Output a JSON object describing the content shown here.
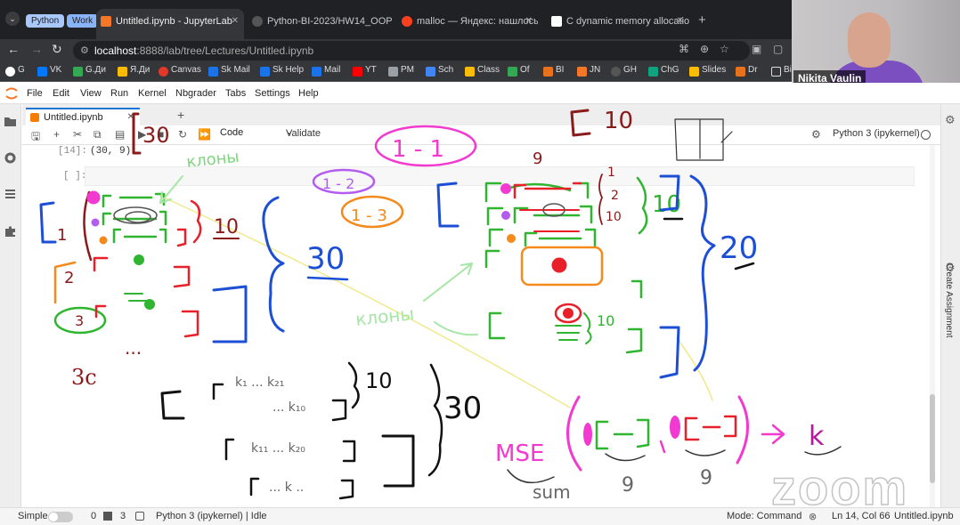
{
  "browser": {
    "tab_groups": [
      {
        "label": "Python",
        "color": "#a8c7fa"
      },
      {
        "label": "Work",
        "color": "#8ab4f8"
      }
    ],
    "tabs": [
      {
        "title": "Untitled.ipynb - JupyterLab",
        "active": true,
        "icon": "jupyter-icon"
      },
      {
        "title": "Python-BI-2023/HW14_OOP: Tr",
        "active": false,
        "icon": "github-icon"
      },
      {
        "title": "malloc — Яндекс: нашлось 3 т",
        "active": false,
        "icon": "yandex-icon"
      },
      {
        "title": "C dynamic memory allocation -",
        "active": false,
        "icon": "wikipedia-icon"
      }
    ],
    "url_host": "localhost",
    "url_path": ":8888/lab/tree/Lectures/Untitled.ipynb",
    "bookmarks": [
      "G",
      "VK",
      "G.Ди",
      "Я.Ди",
      "Canvas",
      "Sk Mail",
      "Sk Help",
      "Mail",
      "YT",
      "PM",
      "Sch",
      "Class",
      "Of",
      "BI",
      "JN",
      "GH",
      "ChG",
      "Slides",
      "Dr",
      "Bio"
    ]
  },
  "webcam": {
    "name": "Nikita Vaulin"
  },
  "jupyter": {
    "menu": [
      "File",
      "Edit",
      "View",
      "Run",
      "Kernel",
      "Nbgrader",
      "Tabs",
      "Settings",
      "Help"
    ],
    "doc_tab": "Untitled.ipynb",
    "cell_type": "Code",
    "validate_label": "Validate",
    "kernel": "Python 3 (ipykernel)",
    "right_panel_label": "Create Assignment",
    "out_prompt": "[14]:",
    "out_text": "(30, 9)",
    "in_prompt": "[ ]:"
  },
  "annotations": {
    "n30a": "30",
    "n10a": "10",
    "n30b": "30",
    "n10b": "10",
    "n20": "20",
    "n10c": "10",
    "n10d": "10",
    "n30c": "30",
    "klots_a": "клоны",
    "klots_b": "клоны",
    "o1": "1",
    "o2": "2",
    "o3": "3",
    "b11": "1 - 1",
    "b12": "1 - 2",
    "b13": "1 - 3",
    "n9": "9",
    "mse": "MSE",
    "sum": "sum",
    "s9a": "9",
    "s9b": "9",
    "kk": "k",
    "k1": "k₁ ... k₂₁",
    "k1b": "... k₁₀",
    "k2": "k₁₁ ... k₂₀",
    "k3": "... k ..",
    "i1": "1",
    "i2": "2",
    "i10": "10",
    "dots": "...",
    "zc": "3c",
    "n10e": "10"
  },
  "status": {
    "mode_label": "Simple",
    "count_a": "0",
    "count_b": "3",
    "kernel_state": "Python 3 (ipykernel) | Idle",
    "mode": "Mode: Command",
    "position": "Ln 14, Col 66",
    "file": "Untitled.ipynb"
  },
  "watermark": "zoom",
  "colors": {
    "accent": "#1976d2",
    "jupyter_orange": "#f57c00"
  }
}
